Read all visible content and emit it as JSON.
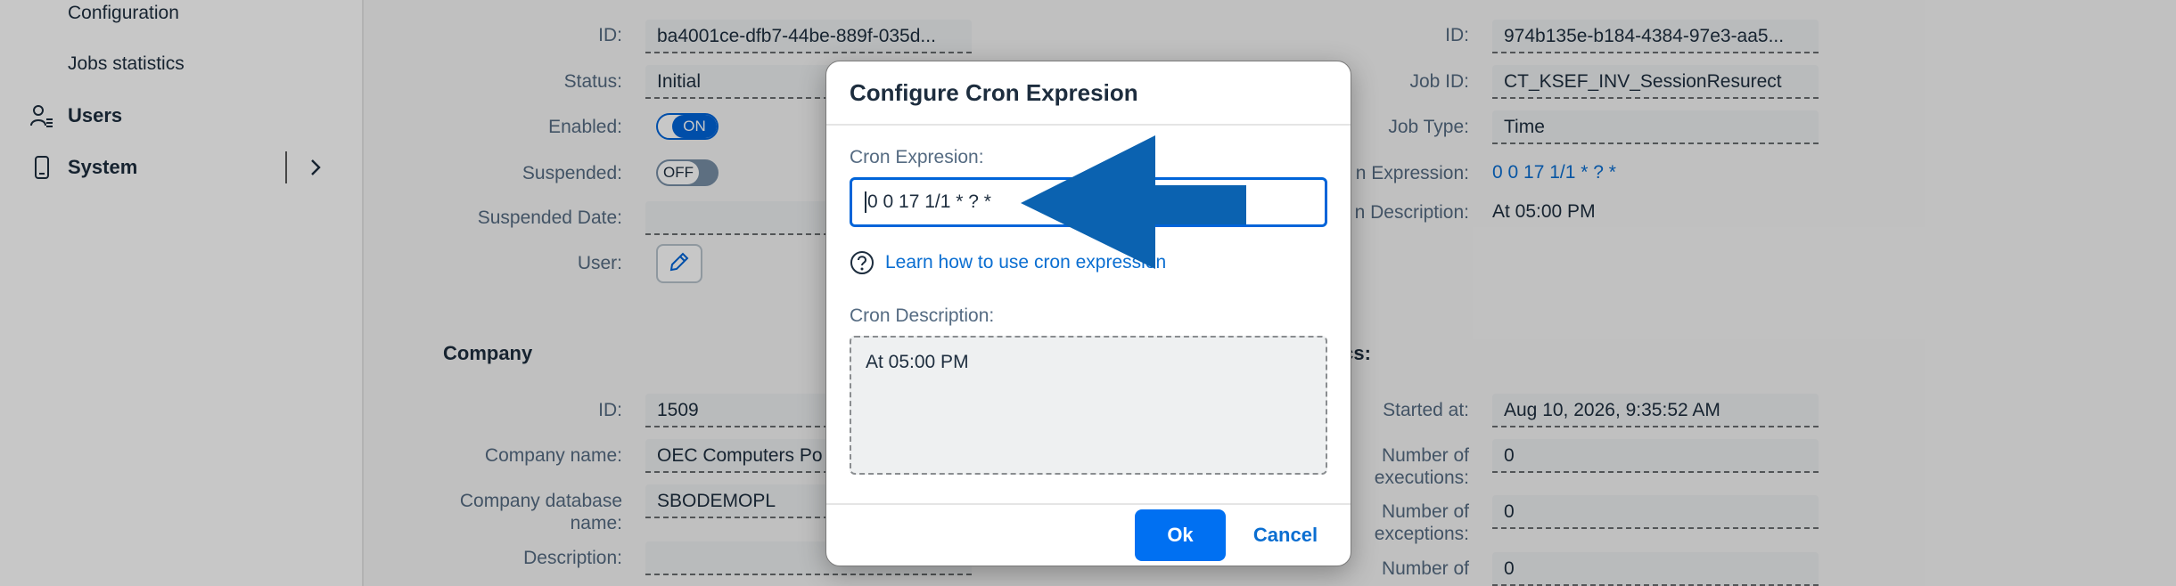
{
  "sidebar": {
    "items": [
      {
        "label": "Configuration",
        "icon": "none"
      },
      {
        "label": "Jobs statistics",
        "icon": "none"
      },
      {
        "label": "Users",
        "icon": "users-icon"
      },
      {
        "label": "System",
        "icon": "phone-icon"
      }
    ]
  },
  "form": {
    "left": {
      "id_label": "ID:",
      "id_value": "ba4001ce-dfb7-44be-889f-035d...",
      "status_label": "Status:",
      "status_value": "Initial",
      "enabled_label": "Enabled:",
      "enabled_toggle": "ON",
      "suspended_label": "Suspended:",
      "suspended_toggle": "OFF",
      "suspended_date_label": "Suspended Date:",
      "suspended_date_value": "",
      "user_label": "User:"
    },
    "right": {
      "id_label": "ID:",
      "id_value": "974b135e-b184-4384-97e3-aa5...",
      "job_id_label": "Job ID:",
      "job_id_value": "CT_KSEF_INV_SessionResurect",
      "job_type_label": "Job Type:",
      "job_type_value": "Time",
      "cron_expr_label": "n Expression:",
      "cron_expr_value": "0 0 17 1/1 * ? *",
      "cron_desc_label": "n Description:",
      "cron_desc_value": "At 05:00 PM"
    },
    "company": {
      "section_title": "Company",
      "id_label": "ID:",
      "id_value": "1509",
      "name_label": "Company name:",
      "name_value": "OEC Computers Po",
      "db_label_line1": "Company database",
      "db_label_line2": "name:",
      "db_value": "SBODEMOPL",
      "desc_label": "Description:",
      "desc_value": ""
    },
    "stats": {
      "section_title": "ics:",
      "started_label": "Started at:",
      "started_value": "Aug 10, 2026, 9:35:52 AM",
      "executions_label_line1": "Number of",
      "executions_label_line2": "executions:",
      "executions_value": "0",
      "exceptions_label_line1": "Number of",
      "exceptions_label_line2": "exceptions:",
      "exceptions_value": "0",
      "more_label_line1": "Number of",
      "more_value": "0"
    }
  },
  "dialog": {
    "title": "Configure Cron Expresion",
    "cron_label": "Cron Expresion:",
    "cron_value": "0 0 17 1/1 * ? *",
    "help_link": "Learn how to use cron expression",
    "desc_label": "Cron Description:",
    "desc_value": "At 05:00 PM",
    "ok_label": "Ok",
    "cancel_label": "Cancel"
  },
  "colors": {
    "accent": "#0070f2",
    "link": "#0a6ed1",
    "annotation_arrow": "#0b62b0"
  }
}
